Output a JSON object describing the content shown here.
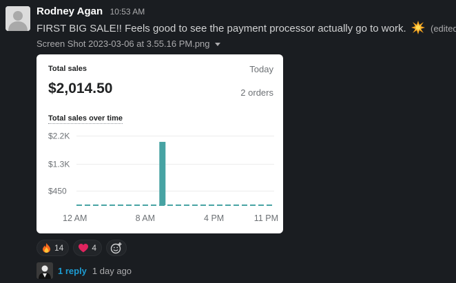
{
  "message": {
    "author": "Rodney Agan",
    "timestamp": "10:53 AM",
    "text": "FIRST BIG SALE!! Feels good to see the payment processor actually go to work.",
    "emoji": "collision-emoji",
    "edited_label": "(edited)"
  },
  "attachment": {
    "file_name": "Screen Shot 2023-03-06 at 3.55.16 PM.png"
  },
  "card": {
    "label": "Total sales",
    "period": "Today",
    "amount": "$2,014.50",
    "orders": "2 orders",
    "chart_title": "Total sales over time"
  },
  "chart_data": {
    "type": "bar",
    "title": "Total sales over time",
    "xlabel": "",
    "ylabel": "",
    "y_ticks": [
      "$2.2K",
      "$1.3K",
      "$450"
    ],
    "y_tick_values": [
      2200,
      1300,
      450
    ],
    "x_ticks": [
      "12 AM",
      "8 AM",
      "4 PM",
      "11 PM"
    ],
    "ylim": [
      0,
      2300
    ],
    "hour_range": [
      0,
      23
    ],
    "grid": true,
    "color": "#47a3a3",
    "bars": [
      {
        "hour": 10,
        "value": 2014.5
      }
    ],
    "baseline": "dashed"
  },
  "reactions": [
    {
      "emoji": "fire-emoji",
      "count": "14"
    },
    {
      "emoji": "heart-emoji",
      "count": "4"
    }
  ],
  "thread": {
    "reply_label": "1 reply",
    "last_reply": "1 day ago"
  }
}
